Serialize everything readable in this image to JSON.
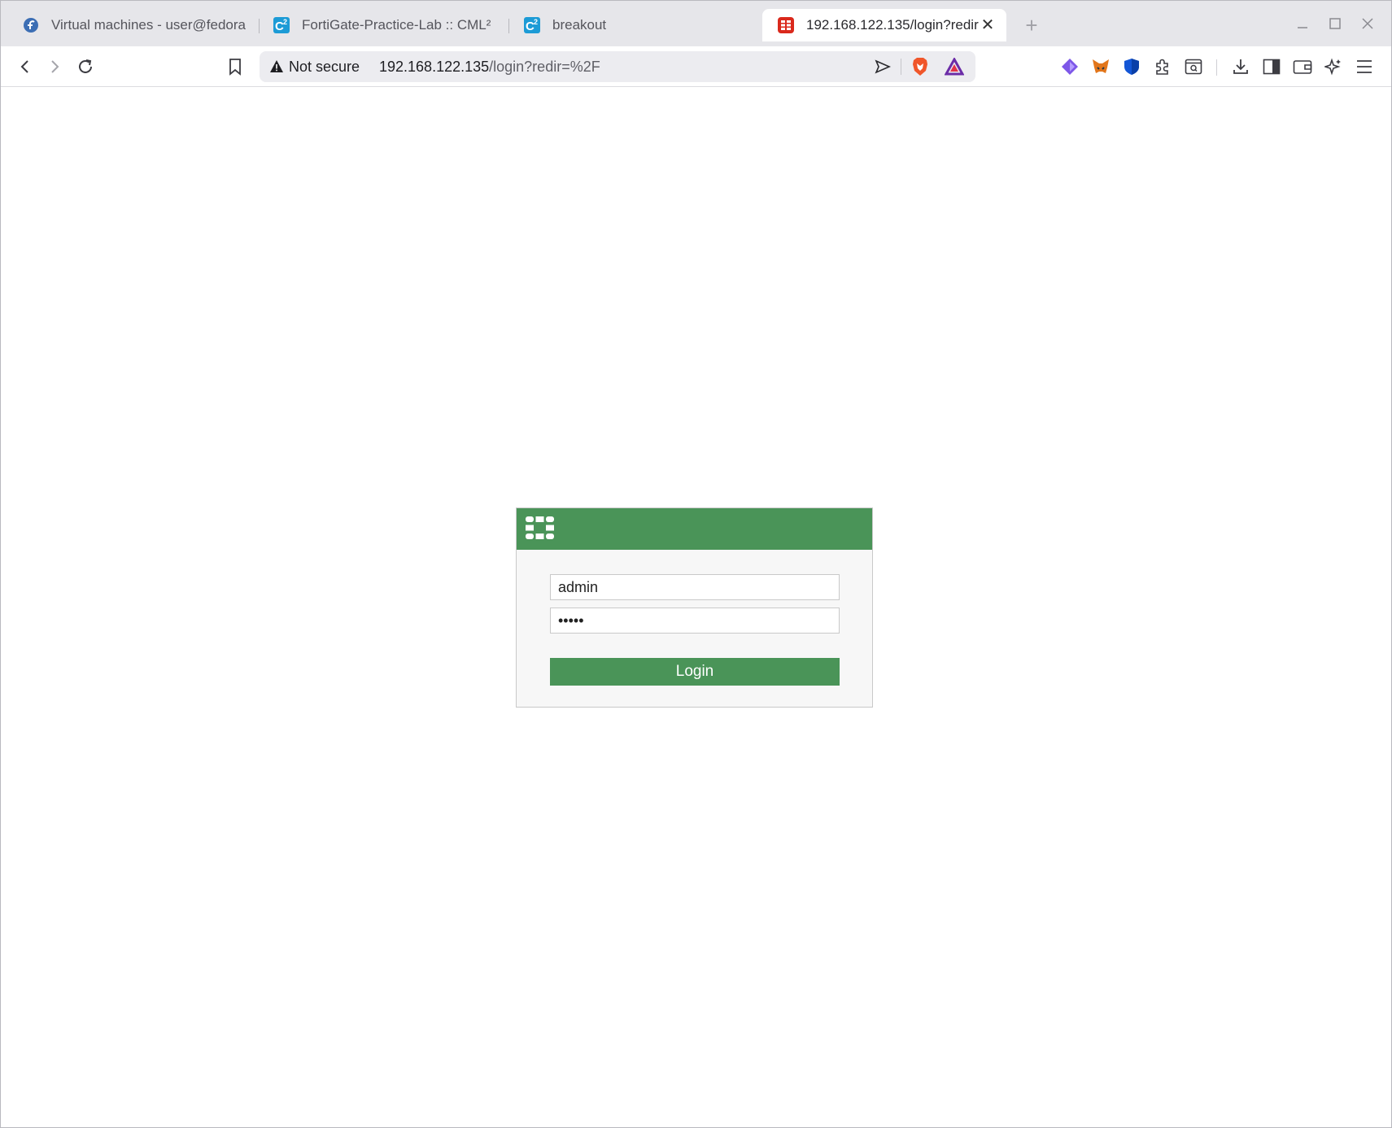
{
  "browser": {
    "tabs": [
      {
        "title": "Virtual machines - user@fedora",
        "favicon": "fedora-icon"
      },
      {
        "title": "FortiGate-Practice-Lab :: CML²",
        "favicon": "cml-icon"
      },
      {
        "title": "breakout",
        "favicon": "cml-icon"
      },
      {
        "title": "192.168.122.135/login?redir",
        "favicon": "fortinet-icon",
        "active": true
      }
    ],
    "address_bar": {
      "security_label": "Not secure",
      "url_host": "192.168.122.135",
      "url_path": "/login?redir=%2F"
    }
  },
  "login": {
    "username": "admin",
    "password": "admin",
    "button_label": "Login"
  },
  "colors": {
    "brand_green": "#4a9458",
    "brave_orange": "#f0562a"
  }
}
